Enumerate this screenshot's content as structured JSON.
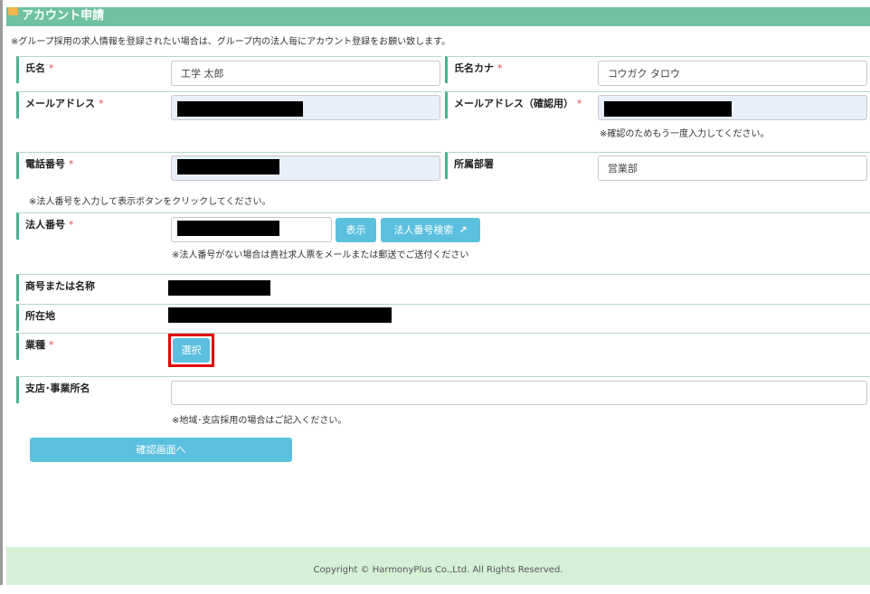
{
  "header": {
    "title": "アカウント申請"
  },
  "top_note": "※グループ採用の求人情報を登録されたい場合は、グループ内の法人毎にアカウント登録をお願い致します。",
  "required_mark": "*",
  "fields": {
    "name": {
      "label": "氏名",
      "value": "工学 太郎"
    },
    "name_kana": {
      "label": "氏名カナ",
      "value": "コウガク タロウ"
    },
    "email": {
      "label": "メールアドレス"
    },
    "email_confirm": {
      "label": "メールアドレス（確認用）",
      "note": "※確認のためもう一度入力してください。"
    },
    "phone": {
      "label": "電話番号"
    },
    "department": {
      "label": "所属部署",
      "value": "営業部"
    },
    "corp_note": "※法人番号を入力して表示ボタンをクリックしてください。",
    "corp_number": {
      "label": "法人番号",
      "show_button": "表示",
      "search_button": "法人番号検索",
      "note": "※法人番号がない場合は貴社求人票をメールまたは郵送でご送付ください"
    },
    "trade_name": {
      "label": "商号または名称"
    },
    "address": {
      "label": "所在地"
    },
    "industry": {
      "label": "業種",
      "select_button": "選択"
    },
    "branch": {
      "label": "支店･事業所名",
      "value": "",
      "note": "※地域･支店採用の場合はご記入ください。"
    }
  },
  "confirm_button": "確認画面へ",
  "footer": {
    "copyright": "Copyright © HarmonyPlus Co.,Ltd. All Rights Reserved."
  },
  "colors": {
    "header": "#6ec1a1",
    "button": "#5bc0de",
    "footer": "#d6f0d6",
    "highlight": "#e00000"
  }
}
